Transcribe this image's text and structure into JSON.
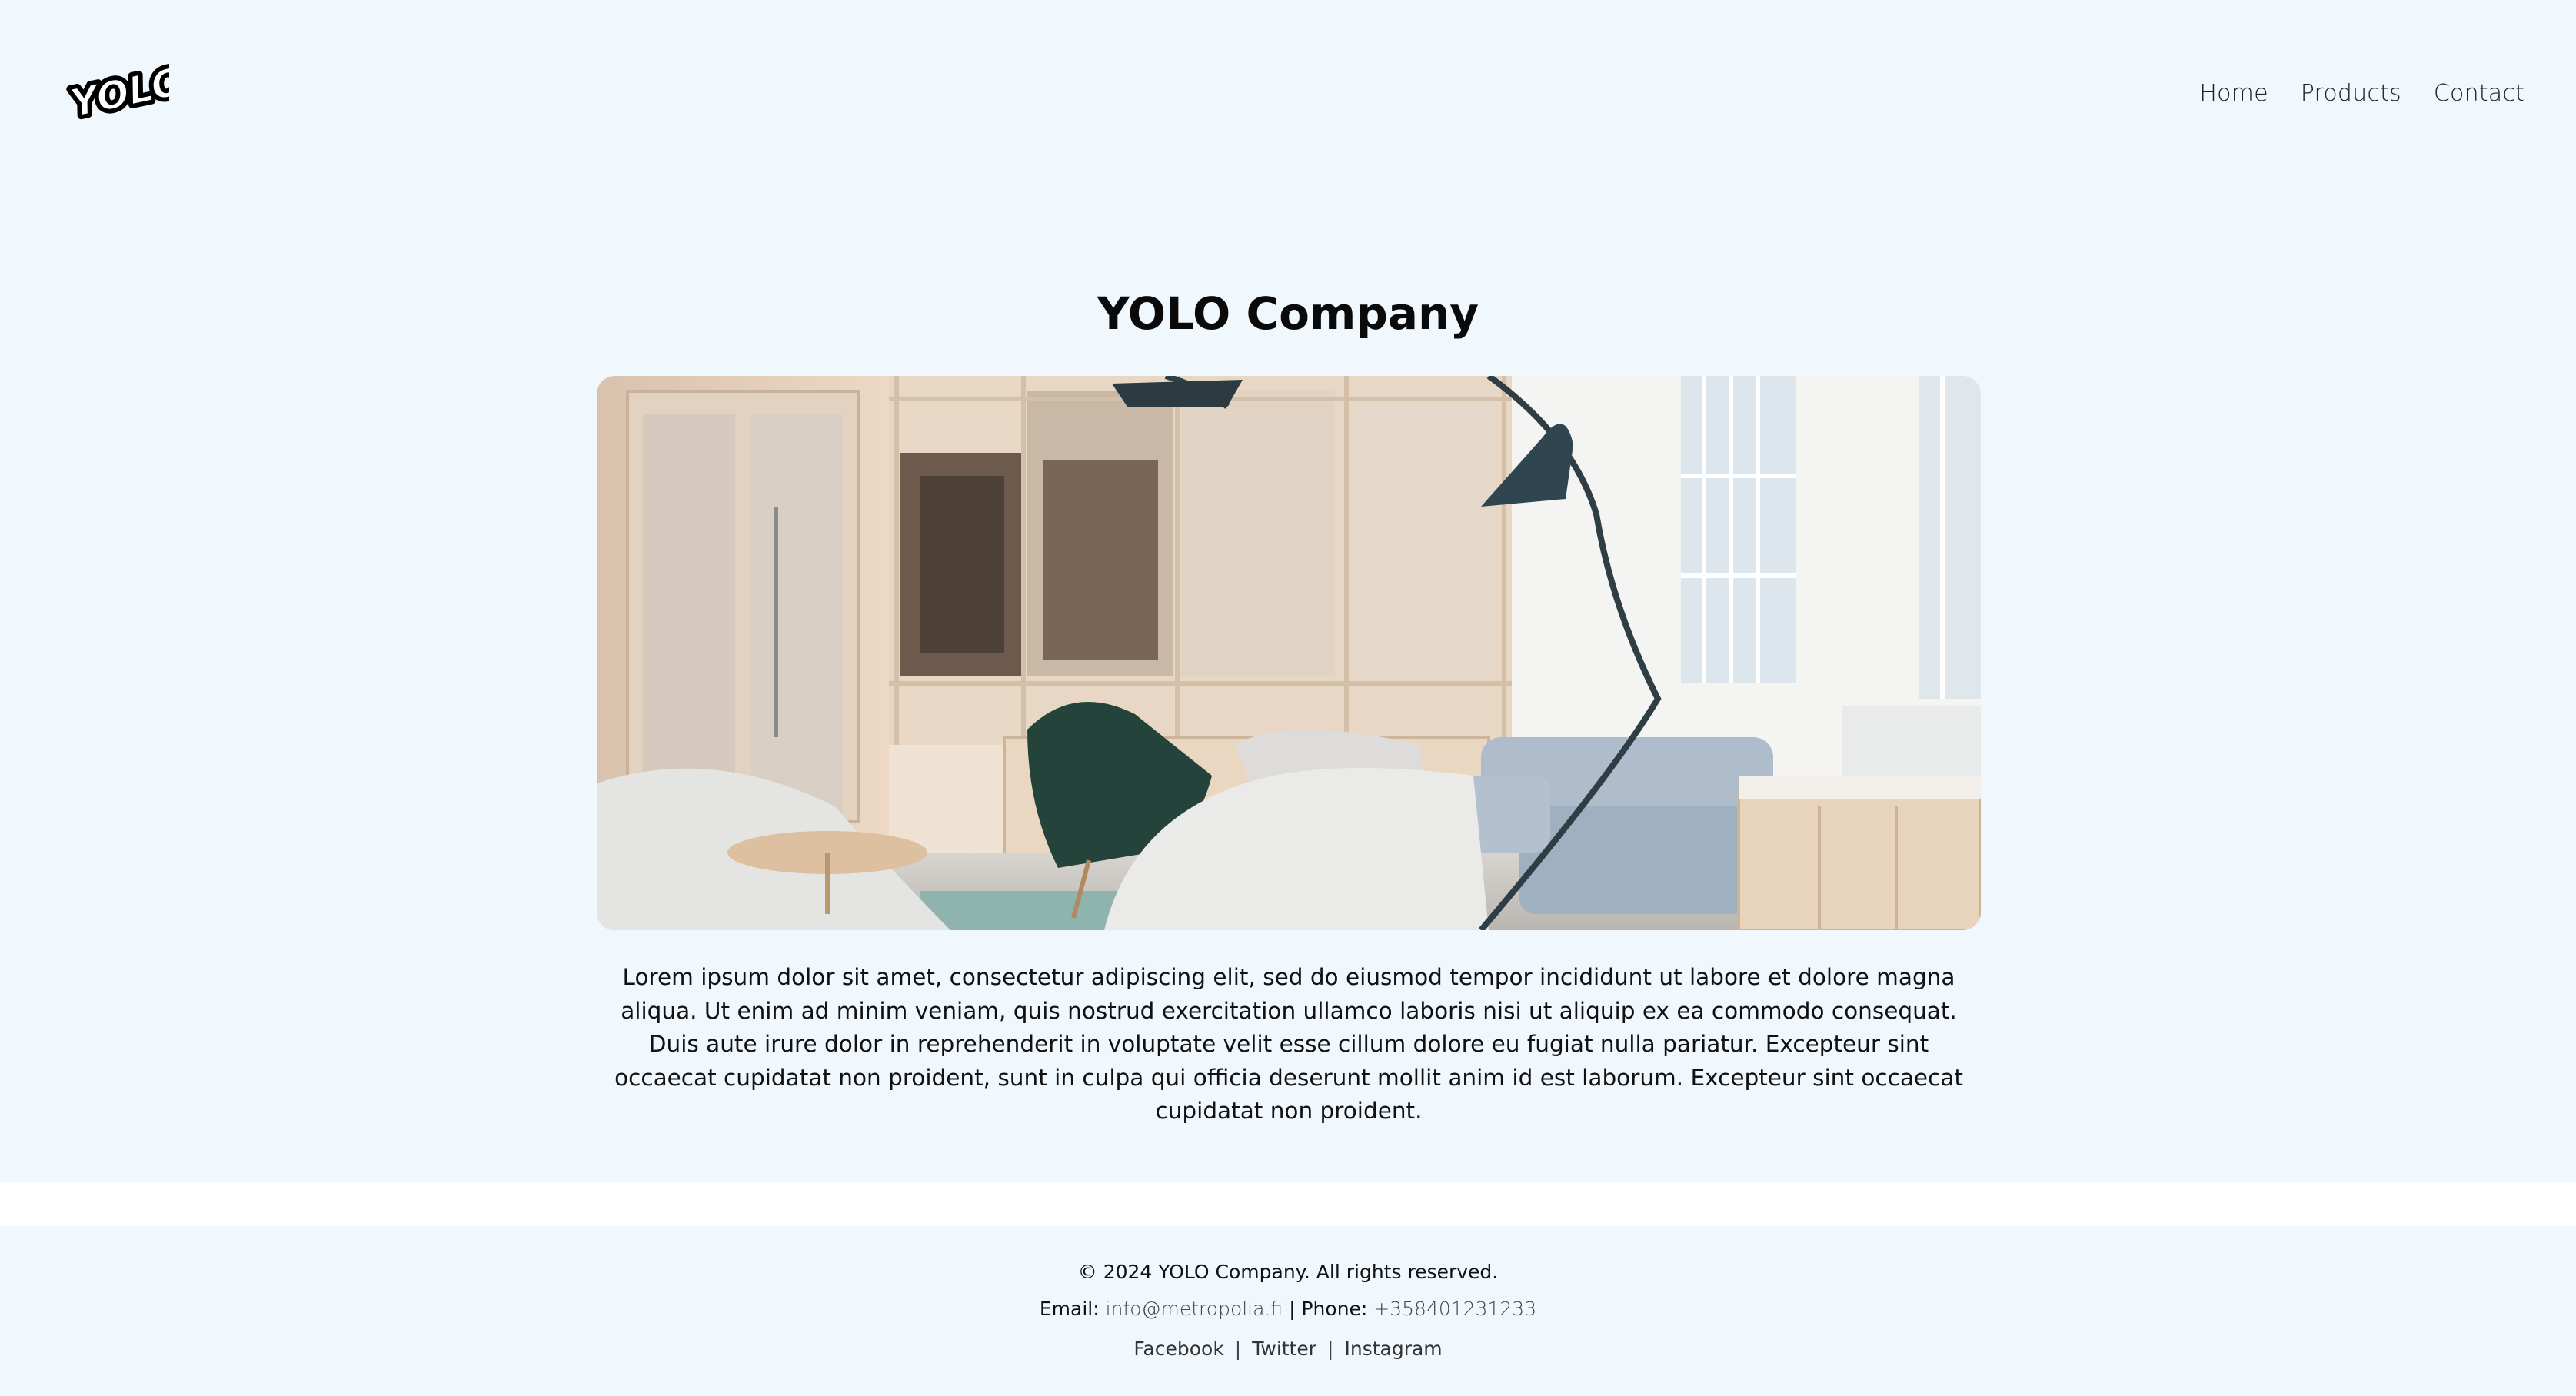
{
  "header": {
    "logo_text": "YOLO",
    "nav": [
      {
        "label": "Home"
      },
      {
        "label": "Products"
      },
      {
        "label": "Contact"
      }
    ]
  },
  "main": {
    "title": "YOLO Company",
    "hero_image": "office-lounge-photo",
    "paragraph": "Lorem ipsum dolor sit amet, consectetur adipiscing elit, sed do eiusmod tempor incididunt ut labore et dolore magna aliqua. Ut enim ad minim veniam, quis nostrud exercitation ullamco laboris nisi ut aliquip ex ea commodo consequat. Duis aute irure dolor in reprehenderit in voluptate velit esse cillum dolore eu fugiat nulla pariatur. Excepteur sint occaecat cupidatat non proident, sunt in culpa qui officia deserunt mollit anim id est laborum. Excepteur sint occaecat cupidatat non proident."
  },
  "footer": {
    "copyright": "© 2024 YOLO Company. All rights reserved.",
    "email_label": "Email:",
    "email": "info@metropolia.fi",
    "phone_label": "| Phone:",
    "phone": "+358401231233",
    "social": [
      {
        "label": "Facebook"
      },
      {
        "label": "Twitter"
      },
      {
        "label": "Instagram"
      }
    ],
    "separator": "|"
  },
  "colors": {
    "page_bg": "#f0f7fd",
    "text": "#111111"
  }
}
